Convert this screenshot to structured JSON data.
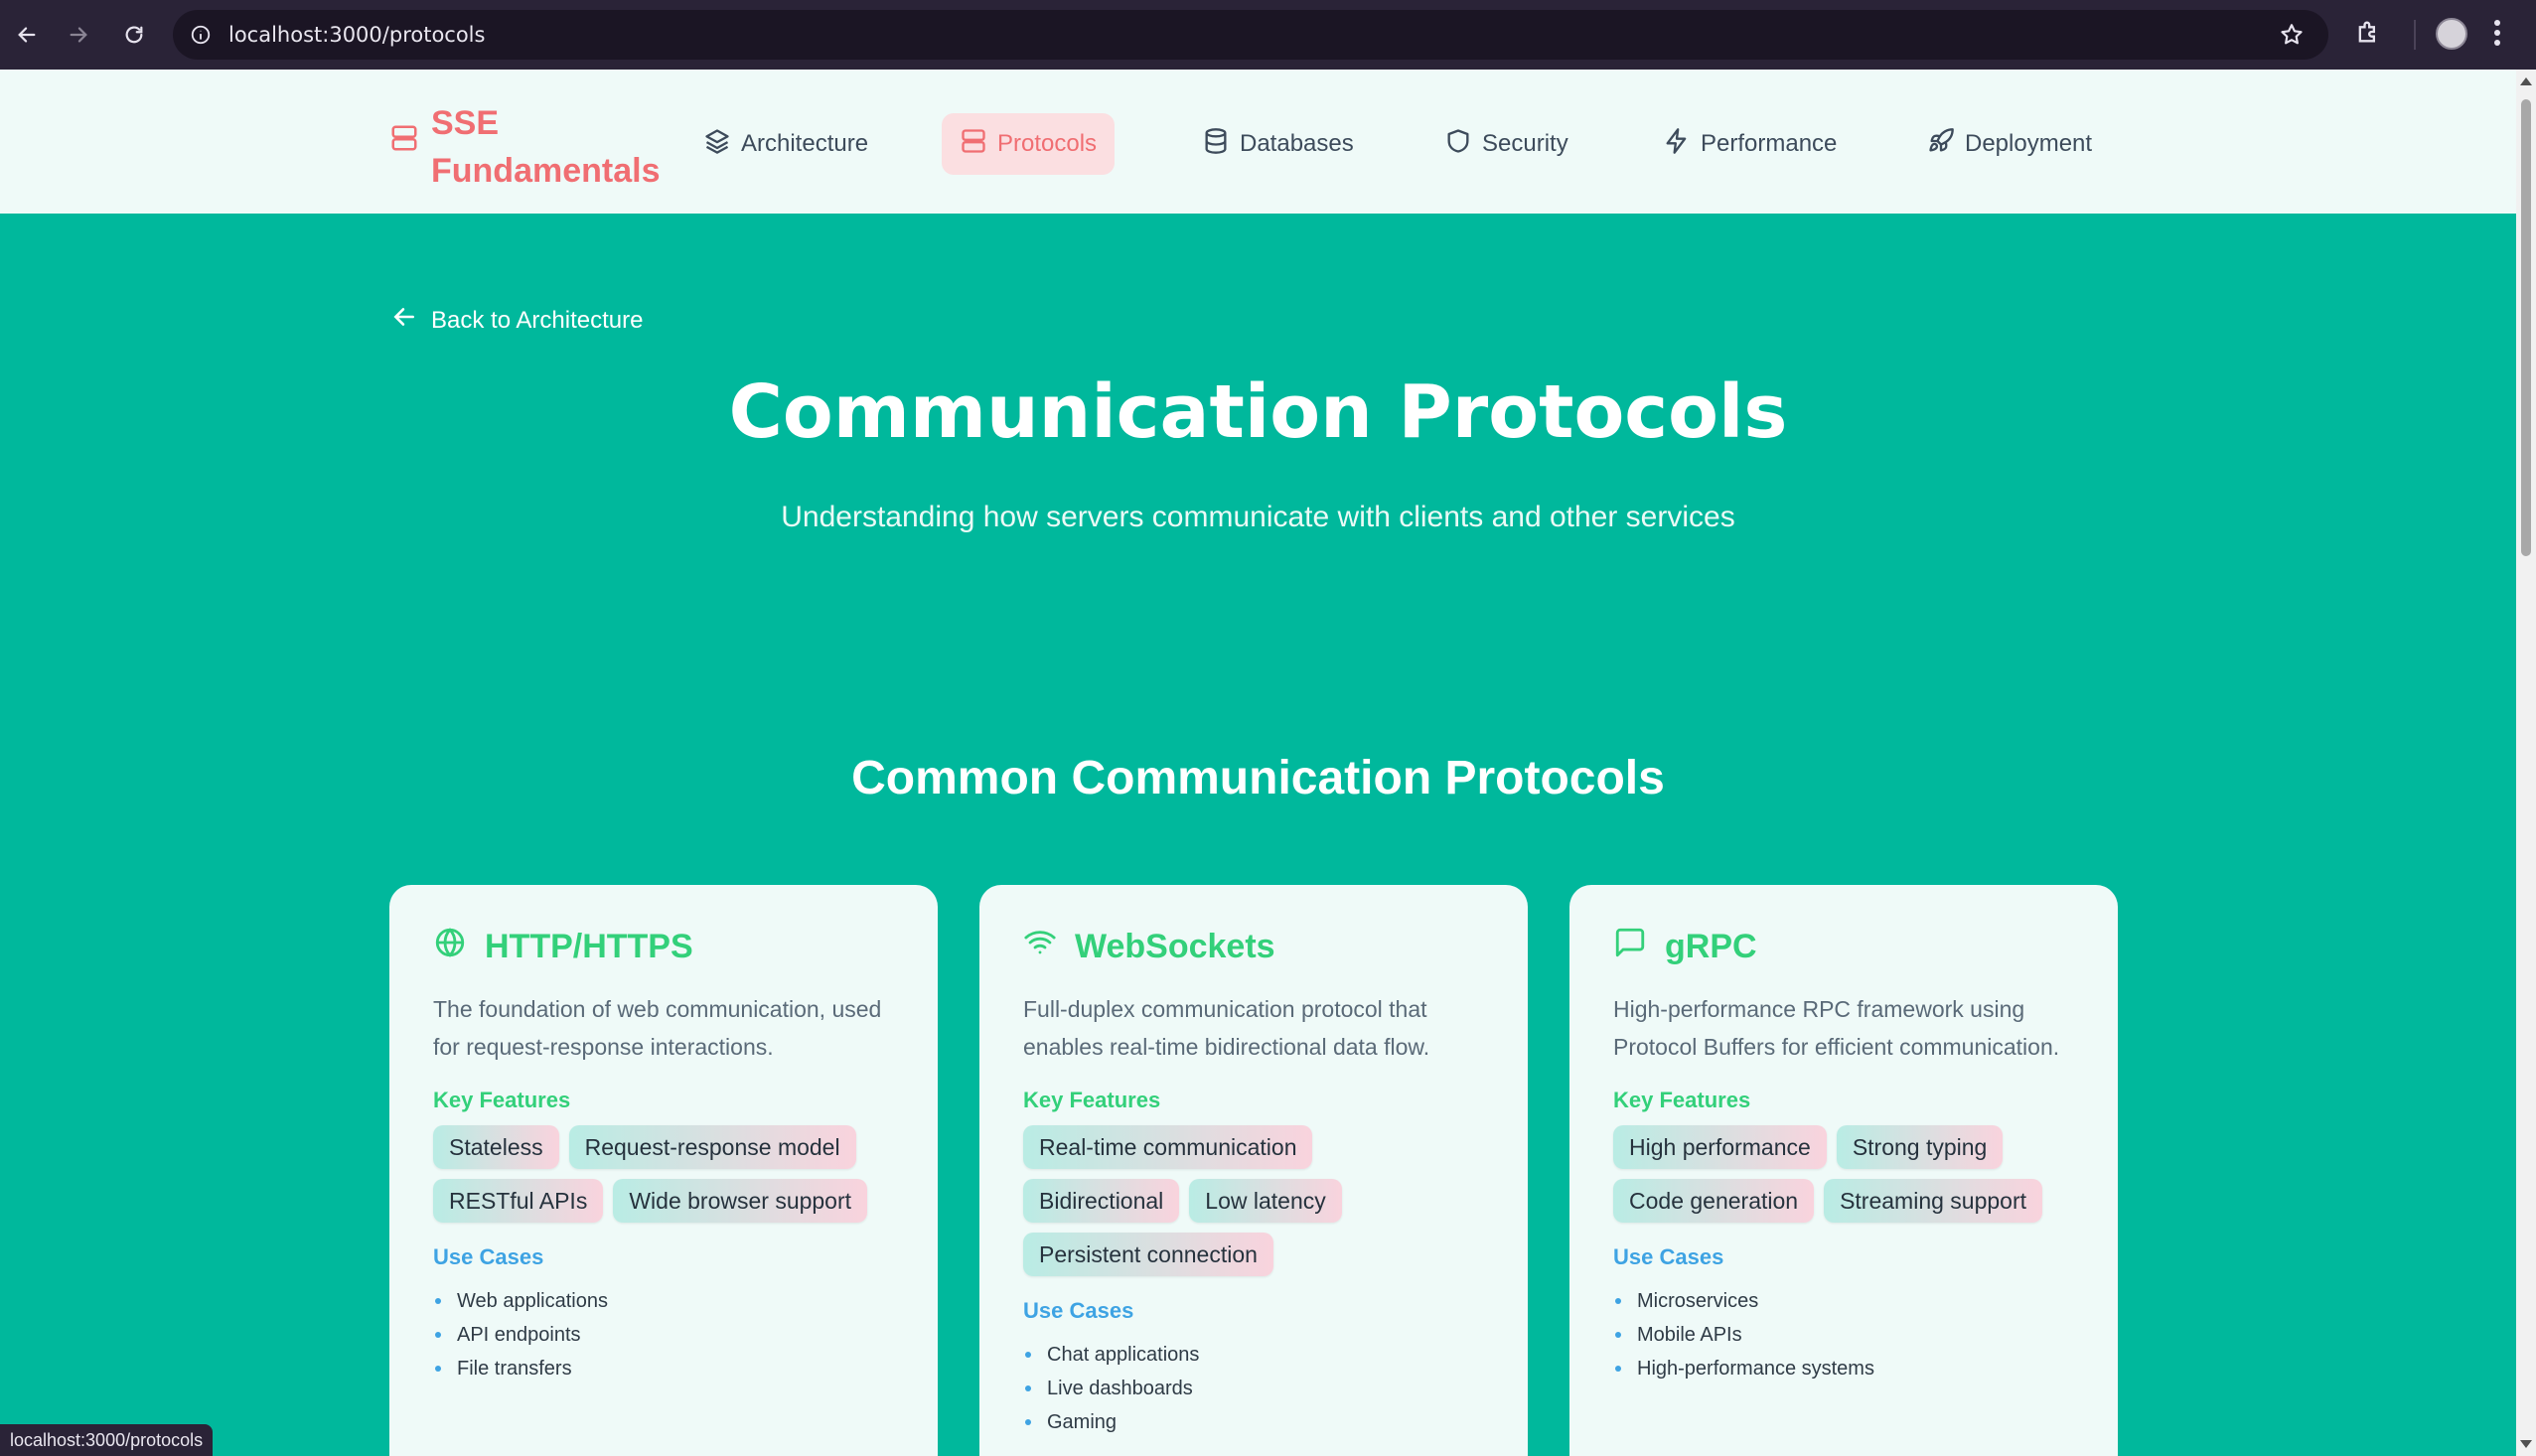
{
  "browser": {
    "url": "localhost:3000/protocols",
    "status_url": "localhost:3000/protocols"
  },
  "header": {
    "brand": "SSE Fundamentals",
    "nav": [
      {
        "label": "Architecture",
        "icon": "layers-icon",
        "active": false
      },
      {
        "label": "Protocols",
        "icon": "server-icon",
        "active": true
      },
      {
        "label": "Databases",
        "icon": "database-icon",
        "active": false
      },
      {
        "label": "Security",
        "icon": "shield-icon",
        "active": false
      },
      {
        "label": "Performance",
        "icon": "zap-icon",
        "active": false
      },
      {
        "label": "Deployment",
        "icon": "rocket-icon",
        "active": false
      }
    ]
  },
  "hero": {
    "back_label": "Back to Architecture",
    "title": "Communication Protocols",
    "subtitle": "Understanding how servers communicate with clients and other services"
  },
  "section": {
    "title": "Common Communication Protocols"
  },
  "labels": {
    "features": "Key Features",
    "use_cases": "Use Cases"
  },
  "cards": [
    {
      "title": "HTTP/HTTPS",
      "icon": "globe-icon",
      "description": "The foundation of web communication, used for request-response interactions.",
      "features": [
        "Stateless",
        "Request-response model",
        "RESTful APIs",
        "Wide browser support"
      ],
      "use_cases": [
        "Web applications",
        "API endpoints",
        "File transfers"
      ]
    },
    {
      "title": "WebSockets",
      "icon": "wifi-icon",
      "description": "Full-duplex communication protocol that enables real-time bidirectional data flow.",
      "features": [
        "Real-time communication",
        "Bidirectional",
        "Low latency",
        "Persistent connection"
      ],
      "use_cases": [
        "Chat applications",
        "Live dashboards",
        "Gaming"
      ]
    },
    {
      "title": "gRPC",
      "icon": "message-square-icon",
      "description": "High-performance RPC framework using Protocol Buffers for efficient communication.",
      "features": [
        "High performance",
        "Strong typing",
        "Code generation",
        "Streaming support"
      ],
      "use_cases": [
        "Microservices",
        "Mobile APIs",
        "High-performance systems"
      ]
    }
  ],
  "colors": {
    "accent": "#f06e72",
    "hero_bg": "#00b89c",
    "green": "#33d07a",
    "blue": "#3ea3e3"
  }
}
